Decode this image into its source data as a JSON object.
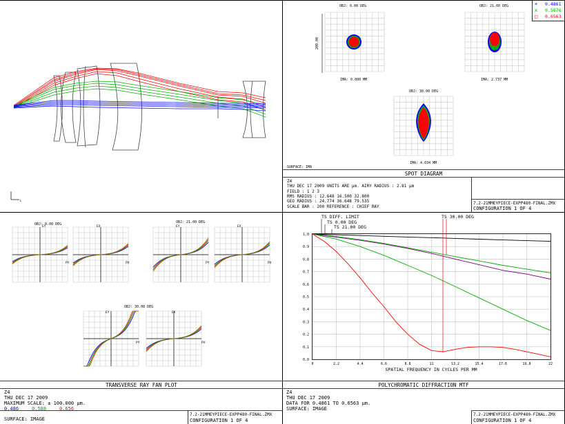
{
  "legend": {
    "items": [
      {
        "symbol": "+",
        "label": "0.4861",
        "color": "#0000ff"
      },
      {
        "symbol": "x",
        "label": "0.5876",
        "color": "#00b000"
      },
      {
        "symbol": "□",
        "label": "0.6563",
        "color": "#ff0000"
      }
    ]
  },
  "layout": {
    "axis_label": "L"
  },
  "spot": {
    "obj1": "OBJ: 0.00 DEG",
    "obj2": "OBJ: 21.00 DEG",
    "obj3": "OBJ: 30.00 DEG",
    "ima1": "IMA: 0.000 MM",
    "ima2": "IMA: 2.737 MM",
    "ima3": "IMA: 4.034 MM",
    "scale_label": "200.00",
    "surface": "SURFACE: IMA",
    "title": "SPOT DIAGRAM",
    "info": [
      "Z4",
      "THU DEC 17 2009   UNITS ARE µm.   AIRY RADIUS : 2.81 µm",
      "FIELD        :         1         2         3",
      "RMS RADIUS   :    12.648    16.500    32.800",
      "GEO RADIUS   :    24.774    36.648    79.535",
      "SCALE BAR    :     200         REFERENCE  : CHIEF RAY"
    ],
    "file": "7.2-21MMEYPIECE-EXPP480-FINAL.ZMX",
    "config": "CONFIGURATION  1  OF  4"
  },
  "fan": {
    "title": "TRANSVERSE RAY FAN PLOT",
    "obj1": "OBJ: 0.00 DEG",
    "obj2": "OBJ: 21.00 DEG",
    "obj3": "OBJ: 30.00 DEG",
    "ey": "EY",
    "ex": "EX",
    "py": "PY",
    "px": "PX",
    "info": [
      "Z4",
      "THU DEC 17 2009",
      "MAXIMUM SCALE: ± 100.000 µm."
    ],
    "wavelengths": [
      {
        "label": "0.486",
        "color": "#0000ff"
      },
      {
        "label": "0.588",
        "color": "#00b000"
      },
      {
        "label": "0.656",
        "color": "#ff0000"
      }
    ],
    "surface": "SURFACE: IMAGE",
    "file": "7.2-21MMEYPIECE-EXPP480-FINAL.ZMX",
    "config": "CONFIGURATION  1  OF  4"
  },
  "mtf": {
    "title": "POLYCHROMATIC DIFFRACTION MTF",
    "labels": {
      "diff": "TS DIFF. LIMIT",
      "f1": "TS 0.00 DEG",
      "f2": "TS 21.00 DEG",
      "f3": "TS 30.00 DEG"
    },
    "xlabel": "SPATIAL FREQUENCY IN CYCLES PER MM",
    "info": [
      "Z4",
      "THU DEC 17 2009",
      "DATA FOR 0.4861 TO 0.6563 µm.",
      "SURFACE: IMAGE"
    ],
    "file": "7.2-21MMEYPIECE-EXPP480-FINAL.ZMX",
    "config": "CONFIGURATION  1  OF  4"
  },
  "chart_data": {
    "type": "line",
    "title": "POLYCHROMATIC DIFFRACTION MTF",
    "xlabel": "SPATIAL FREQUENCY IN CYCLES PER MM",
    "ylabel": "",
    "xlim": [
      0,
      22
    ],
    "ylim": [
      0,
      1.0
    ],
    "x_ticks": [
      "0",
      "2.2",
      "4.4",
      "6.6",
      "8.8",
      "11",
      "13.2",
      "15.4",
      "17.6",
      "19.8",
      "22"
    ],
    "y_ticks": [
      "0.0",
      "0.1",
      "0.2",
      "0.3",
      "0.4",
      "0.5",
      "0.6",
      "0.7",
      "0.8",
      "0.9",
      "1.0"
    ],
    "grid": true,
    "series": [
      {
        "name": "TS DIFF. LIMIT",
        "color": "#000000",
        "x": [
          0,
          2.2,
          4.4,
          6.6,
          8.8,
          11,
          13.2,
          15.4,
          17.6,
          19.8,
          22
        ],
        "y": [
          1.0,
          0.994,
          0.988,
          0.982,
          0.976,
          0.971,
          0.965,
          0.959,
          0.953,
          0.947,
          0.942
        ]
      },
      {
        "name": "TS 0.00 DEG",
        "color": "#00b000",
        "x": [
          0,
          2.2,
          4.4,
          6.6,
          8.8,
          11,
          13.2,
          15.4,
          17.6,
          19.8,
          22
        ],
        "y": [
          1.0,
          0.98,
          0.955,
          0.925,
          0.89,
          0.855,
          0.82,
          0.785,
          0.75,
          0.72,
          0.69
        ]
      },
      {
        "name": "TS 0.00 DEG (purple)",
        "color": "#800080",
        "x": [
          0,
          2.2,
          4.4,
          6.6,
          8.8,
          11,
          13.2,
          15.4,
          17.6,
          19.8,
          22
        ],
        "y": [
          1.0,
          0.975,
          0.95,
          0.92,
          0.885,
          0.845,
          0.8,
          0.755,
          0.71,
          0.68,
          0.64
        ]
      },
      {
        "name": "TS 21.00 DEG",
        "color": "#00b000",
        "x": [
          0,
          2.2,
          4.4,
          6.6,
          8.8,
          11,
          13.2,
          15.4,
          17.6,
          19.8,
          22
        ],
        "y": [
          1.0,
          0.96,
          0.9,
          0.83,
          0.75,
          0.67,
          0.58,
          0.49,
          0.4,
          0.31,
          0.23
        ]
      },
      {
        "name": "TS 30.00 DEG",
        "color": "#ff0000",
        "x": [
          0,
          1.1,
          2.2,
          3.3,
          4.4,
          5.5,
          6.6,
          7.7,
          8.8,
          9.9,
          11,
          12.1,
          13.2,
          14.3,
          15.4,
          16.5,
          17.6,
          18.7,
          19.8,
          20.9,
          22
        ],
        "y": [
          1.0,
          0.94,
          0.86,
          0.76,
          0.65,
          0.53,
          0.42,
          0.3,
          0.2,
          0.12,
          0.07,
          0.06,
          0.08,
          0.095,
          0.1,
          0.1,
          0.095,
          0.08,
          0.06,
          0.04,
          0.02
        ]
      }
    ]
  }
}
